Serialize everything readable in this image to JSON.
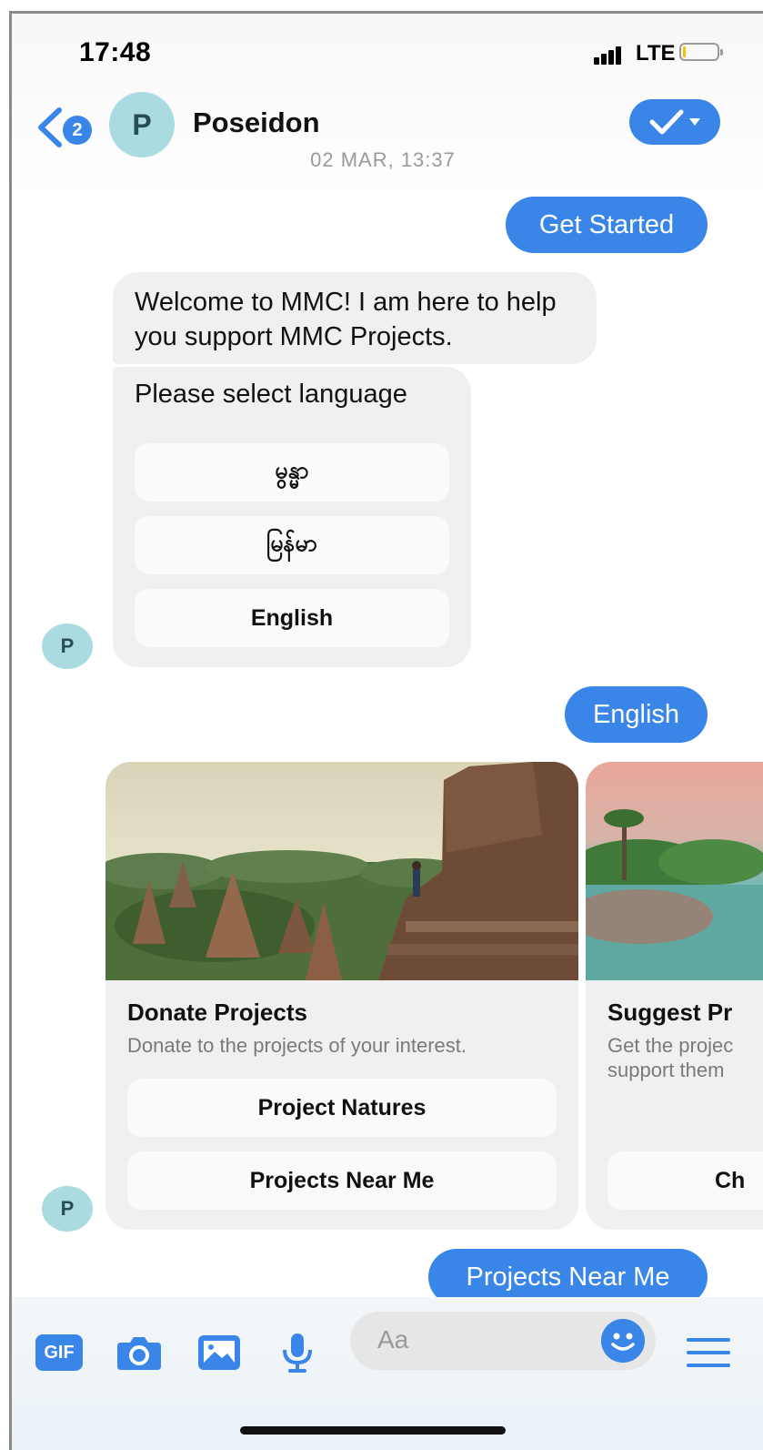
{
  "status_bar": {
    "time": "17:48",
    "network": "LTE"
  },
  "header": {
    "badge_count": "2",
    "avatar_letter": "P",
    "contact_name": "Poseidon"
  },
  "thread": {
    "timestamp": "02 MAR, 13:37",
    "msg_get_started": "Get Started",
    "welcome_text": "Welcome to MMC! I am here to help you support MMC Projects.",
    "language_prompt": "Please select language",
    "language_options": [
      "မွန္မာ",
      "မြန်မာ",
      "English"
    ],
    "avatar_letter": "P",
    "msg_english": "English",
    "msg_projects_near_me": "Projects Near Me"
  },
  "cards": [
    {
      "title": "Donate Projects",
      "subtitle": "Donate to the projects of your interest.",
      "buttons": [
        "Project Natures",
        "Projects Near Me"
      ]
    },
    {
      "title": "Suggest Pr",
      "subtitle_line1": "Get the projec",
      "subtitle_line2": "support them",
      "button": "Ch"
    }
  ],
  "composer": {
    "gif_label": "GIF",
    "placeholder": "Aa",
    "icons": [
      "gif-icon",
      "camera-icon",
      "image-icon",
      "microphone-icon",
      "emoji-icon",
      "menu-icon"
    ]
  },
  "colors": {
    "accent": "#3a86e8",
    "incoming_bubble": "#f0f0f0",
    "avatar_bg": "#a9dbe0"
  }
}
